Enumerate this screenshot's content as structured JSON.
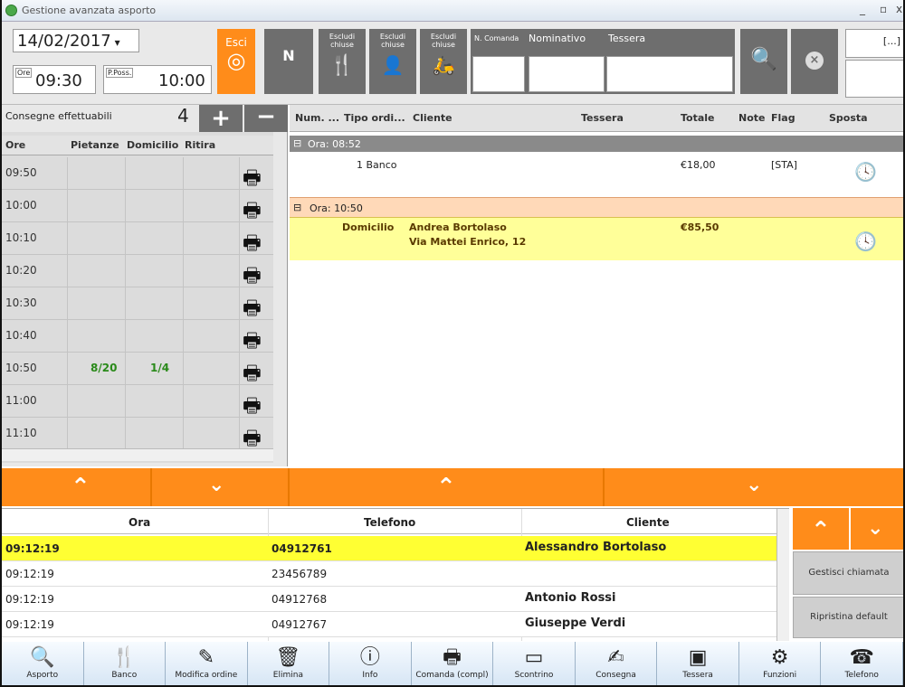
{
  "window": {
    "title": "Gestione avanzata asporto",
    "controls": [
      "_",
      "▫",
      "x"
    ]
  },
  "toolbar": {
    "date": "14/02/2017",
    "ore_label": "Ore",
    "ore_value": "09:30",
    "pposs_label": "P.Poss.",
    "pposs_value": "10:00",
    "esci_label": "Esci",
    "n_label": "N",
    "escludi_1": "Escludi chiuse",
    "escludi_2": "Escludi chiuse",
    "escludi_3": "Escludi chiuse",
    "n_comanda_label": "N. Comanda",
    "nominativo_label": "Nominativo",
    "tessera_label": "Tessera",
    "ellipsis": "[...]"
  },
  "left_panel": {
    "title": "Consegne effettuabili",
    "count": "4",
    "columns": [
      "Ore",
      "Pietanze",
      "Domicilio",
      "Ritira"
    ],
    "rows": [
      {
        "ore": "09:50",
        "pietanze": "",
        "domicilio": ""
      },
      {
        "ore": "10:00",
        "pietanze": "",
        "domicilio": ""
      },
      {
        "ore": "10:10",
        "pietanze": "",
        "domicilio": ""
      },
      {
        "ore": "10:20",
        "pietanze": "",
        "domicilio": ""
      },
      {
        "ore": "10:30",
        "pietanze": "",
        "domicilio": ""
      },
      {
        "ore": "10:40",
        "pietanze": "",
        "domicilio": ""
      },
      {
        "ore": "10:50",
        "pietanze": "8/20",
        "domicilio": "1/4"
      },
      {
        "ore": "11:00",
        "pietanze": "",
        "domicilio": ""
      },
      {
        "ore": "11:10",
        "pietanze": "",
        "domicilio": ""
      }
    ]
  },
  "orders": {
    "columns": [
      "Num. ...",
      "Tipo ordi...",
      "Cliente",
      "Tessera",
      "Totale",
      "Note",
      "Flag",
      "Sposta"
    ],
    "groups": [
      {
        "label": "Ora: 08:52",
        "row": {
          "tipo": "1 Banco",
          "cliente": "",
          "indirizzo": "",
          "totale": "€18,00",
          "flag": "[STA]"
        }
      },
      {
        "label": "Ora: 10:50",
        "row": {
          "tipo": "Domicilio",
          "cliente": "Andrea Bortolaso",
          "indirizzo": "Via Mattei Enrico, 12",
          "totale": "€85,50",
          "flag": ""
        }
      }
    ]
  },
  "calls": {
    "columns": [
      "Ora",
      "Telefono",
      "Cliente"
    ],
    "rows": [
      {
        "ora": "09:12:19",
        "telefono": "04912761",
        "cliente": "Alessandro Bortolaso"
      },
      {
        "ora": "09:12:19",
        "telefono": "23456789",
        "cliente": ""
      },
      {
        "ora": "09:12:19",
        "telefono": "04912768",
        "cliente": "Antonio Rossi"
      },
      {
        "ora": "09:12:19",
        "telefono": "04912767",
        "cliente": "Giuseppe Verdi"
      }
    ],
    "gestisci_label": "Gestisci chiamata",
    "ripristina_label": "Ripristina default"
  },
  "bottom_toolbar": [
    {
      "label": "Asporto",
      "icon": "search-bag-icon",
      "glyph": "🔍"
    },
    {
      "label": "Banco",
      "icon": "fork-knife-icon",
      "glyph": "🍴"
    },
    {
      "label": "Modifica ordine",
      "icon": "edit-icon",
      "glyph": "✎"
    },
    {
      "label": "Elimina",
      "icon": "trash-icon",
      "glyph": "🗑"
    },
    {
      "label": "Info",
      "icon": "info-icon",
      "glyph": "ⓘ"
    },
    {
      "label": "Comanda (compl)",
      "icon": "printer-icon",
      "glyph": "🖶"
    },
    {
      "label": "Scontrino",
      "icon": "cash-icon",
      "glyph": "▭"
    },
    {
      "label": "Consegna",
      "icon": "deliver-icon",
      "glyph": "✍"
    },
    {
      "label": "Tessera",
      "icon": "card-icon",
      "glyph": "▣"
    },
    {
      "label": "Funzioni",
      "icon": "tools-icon",
      "glyph": "⚙"
    },
    {
      "label": "Telefono",
      "icon": "phone-icon",
      "glyph": "☎"
    }
  ],
  "colors": {
    "orange": "#ff8c1a",
    "highlight_yellow": "#ffff33",
    "green_text": "#2a8a1a"
  }
}
